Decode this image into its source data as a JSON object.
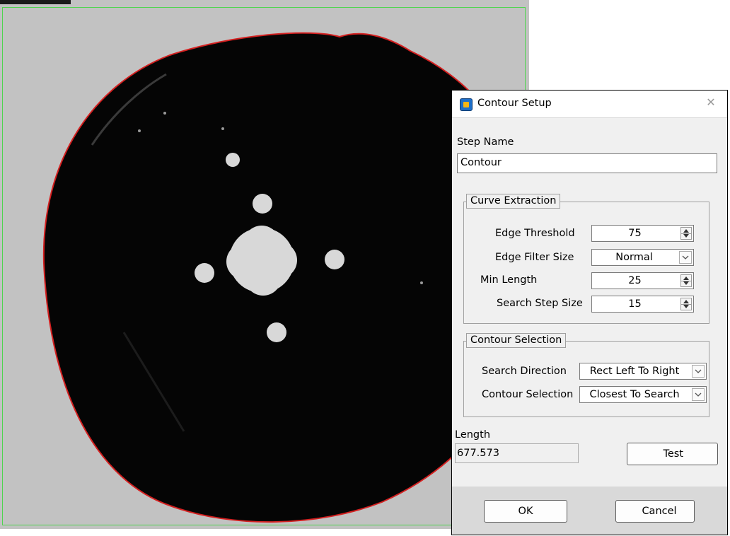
{
  "dialog": {
    "title": "Contour Setup",
    "close_icon": "close-icon",
    "app_icon": "app-logo-icon",
    "step_name": {
      "label": "Step Name",
      "value": "Contour"
    },
    "curve_extraction": {
      "legend": "Curve Extraction",
      "edge_threshold": {
        "label": "Edge Threshold",
        "value": "75"
      },
      "edge_filter_size": {
        "label": "Edge Filter Size",
        "value": "Normal"
      },
      "min_length": {
        "label": "Min Length",
        "value": "25"
      },
      "search_step_size": {
        "label": "Search Step Size",
        "value": "15"
      }
    },
    "contour_selection": {
      "legend": "Contour Selection",
      "search_direction": {
        "label": "Search Direction",
        "value": "Rect Left To Right"
      },
      "contour_selection": {
        "label": "Contour Selection",
        "value": "Closest To Search"
      }
    },
    "length": {
      "label": "Length",
      "value": "677.573"
    },
    "test_label": "Test",
    "ok_label": "OK",
    "cancel_label": "Cancel"
  },
  "colors": {
    "roi_border": "#4fd44f",
    "contour_line": "#d42020",
    "part": "#050505",
    "background": "#c2c2c2"
  }
}
